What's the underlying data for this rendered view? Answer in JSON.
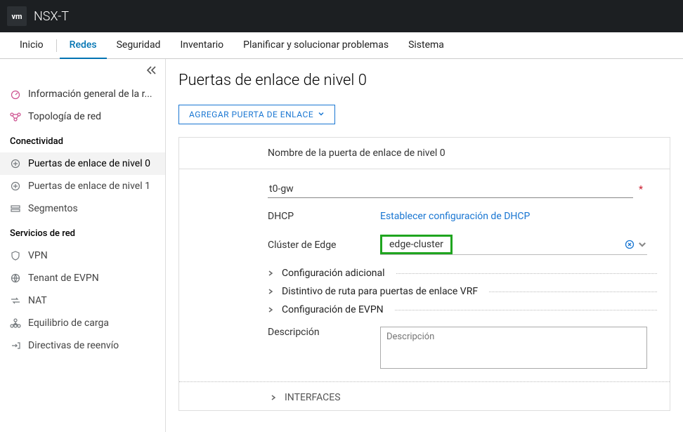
{
  "app": {
    "logo": "vm",
    "title": "NSX-T"
  },
  "mainnav": {
    "items": [
      {
        "label": "Inicio",
        "sep": true
      },
      {
        "label": "Redes",
        "active": true
      },
      {
        "label": "Seguridad"
      },
      {
        "label": "Inventario"
      },
      {
        "label": "Planificar y solucionar problemas"
      },
      {
        "label": "Sistema"
      }
    ]
  },
  "sidebar": {
    "top": [
      {
        "label": "Información general de la r...",
        "icon": "gauge"
      },
      {
        "label": "Topología de red",
        "icon": "topology"
      }
    ],
    "group1": {
      "title": "Conectividad",
      "items": [
        {
          "label": "Puertas de enlace de nivel 0",
          "icon": "gateway",
          "active": true
        },
        {
          "label": "Puertas de enlace de nivel 1",
          "icon": "gateway"
        },
        {
          "label": "Segmentos",
          "icon": "segments"
        }
      ]
    },
    "group2": {
      "title": "Servicios de red",
      "items": [
        {
          "label": "VPN",
          "icon": "shield"
        },
        {
          "label": "Tenant de EVPN",
          "icon": "evpn"
        },
        {
          "label": "NAT",
          "icon": "nat"
        },
        {
          "label": "Equilibrio de carga",
          "icon": "lb"
        },
        {
          "label": "Directivas de reenvío",
          "icon": "fwd"
        }
      ]
    }
  },
  "page": {
    "title": "Puertas de enlace de nivel 0",
    "add_button": "AGREGAR PUERTA DE ENLACE",
    "panel_header": "Nombre de la puerta de enlace de nivel 0",
    "name_value": "t0-gw",
    "dhcp_label": "DHCP",
    "dhcp_link": "Establecer configuración de DHCP",
    "cluster_label": "Clúster de Edge",
    "cluster_value": "edge-cluster",
    "exp": [
      "Configuración adicional",
      "Distintivo de ruta para puertas de enlace VRF",
      "Configuración de EVPN"
    ],
    "desc_label": "Descripción",
    "desc_placeholder": "Descripción",
    "interfaces_label": "INTERFACES"
  }
}
